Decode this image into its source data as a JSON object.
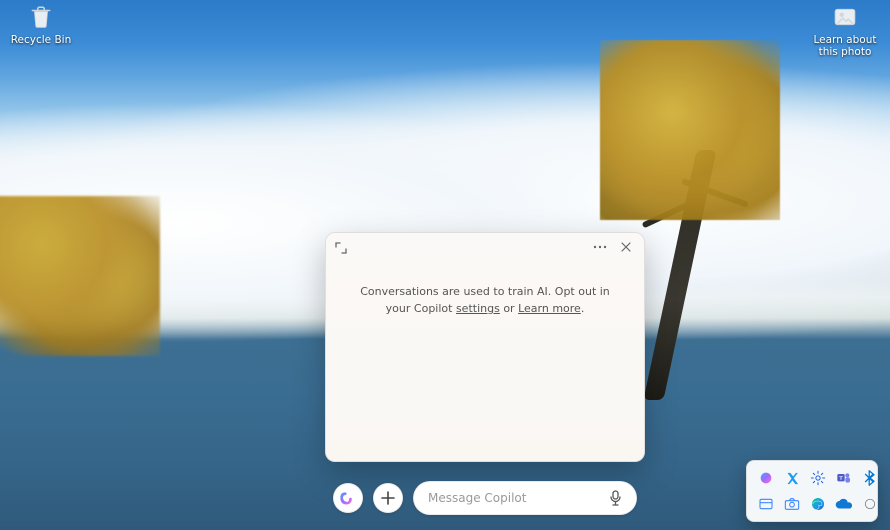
{
  "desktop": {
    "icons": {
      "recycle_bin": "Recycle Bin",
      "learn_about": "Learn about this photo"
    }
  },
  "copilot": {
    "notice_prefix": "Conversations are used to train AI. Opt out in your Copilot ",
    "settings_link": "settings",
    "notice_mid": " or ",
    "learn_more_link": "Learn more",
    "notice_suffix": ".",
    "input_placeholder": "Message Copilot",
    "buttons": {
      "expand": "Expand",
      "more": "More",
      "close": "Close",
      "new": "New topic",
      "mic": "Voice input"
    }
  },
  "tray": {
    "items": [
      "copilot-icon",
      "x-twitter-icon",
      "settings-icon",
      "teams-icon",
      "bluetooth-icon",
      "screenshot-icon",
      "camera-icon",
      "edge-icon",
      "onedrive-icon",
      "unknown-icon"
    ]
  }
}
